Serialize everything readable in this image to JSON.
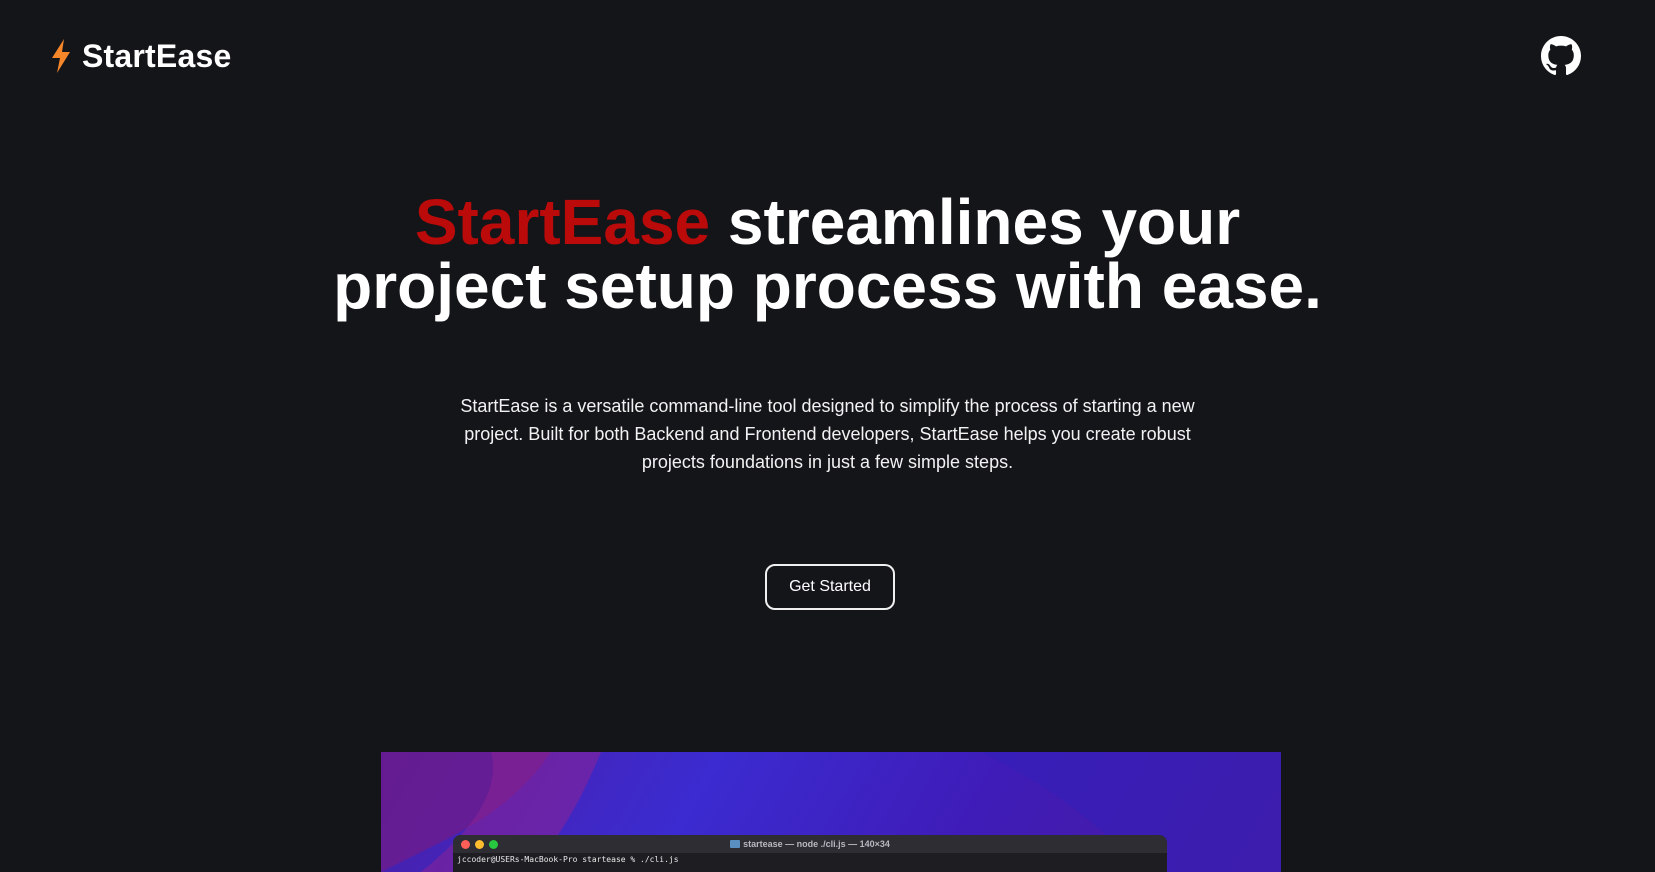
{
  "header": {
    "brand_name": "StartEase",
    "logo_icon": "lightning-bolt-icon",
    "github_icon": "github-icon"
  },
  "hero": {
    "title_accent": "StartEase",
    "title_rest_line1": " streamlines your",
    "title_line2": "project setup process with ease.",
    "description": "StartEase is a versatile command-line tool designed to simplify the process of starting a new project. Built for both Backend and Frontend developers, StartEase helps you create robust projects foundations in just a few simple steps.",
    "cta_label": "Get Started"
  },
  "preview": {
    "terminal_title": "startease — node ./cli.js — 140×34",
    "terminal_line": "jccoder@USERs-MacBook-Pro startease % ./cli.js"
  },
  "colors": {
    "background": "#141519",
    "accent": "#bb0a0a",
    "logo": "#f5862a",
    "text": "#ffffff"
  }
}
